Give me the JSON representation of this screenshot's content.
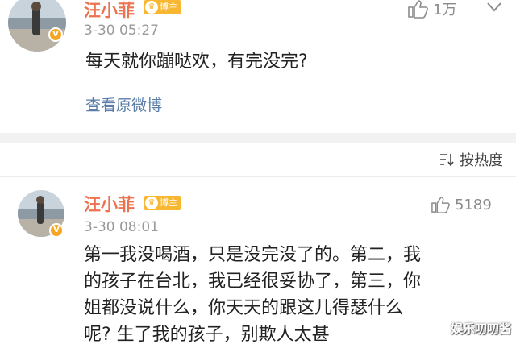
{
  "post": {
    "author": "汪小菲",
    "badge": "博主",
    "time": "3-30 05:27",
    "text": "每天就你蹦哒欢，有完没完?",
    "view_original": "查看原微博",
    "like_count": "1万"
  },
  "sort": {
    "label": "按热度"
  },
  "comment": {
    "author": "汪小菲",
    "badge": "博主",
    "time": "3-30 08:01",
    "like_count": "5189",
    "lines": [
      "第一我没喝酒，只是没完没了的。第二，我",
      "的孩子在台北，我已经很妥协了，第三，你",
      "姐都没说什么，你天天的跟这儿得瑟什么",
      "呢? 生了我的孩子，别欺人太甚"
    ]
  },
  "watermark": "娱乐叨叨酱",
  "colors": {
    "name": "#eb7350",
    "link": "#5a7ea8",
    "badge": "#f7b731"
  }
}
